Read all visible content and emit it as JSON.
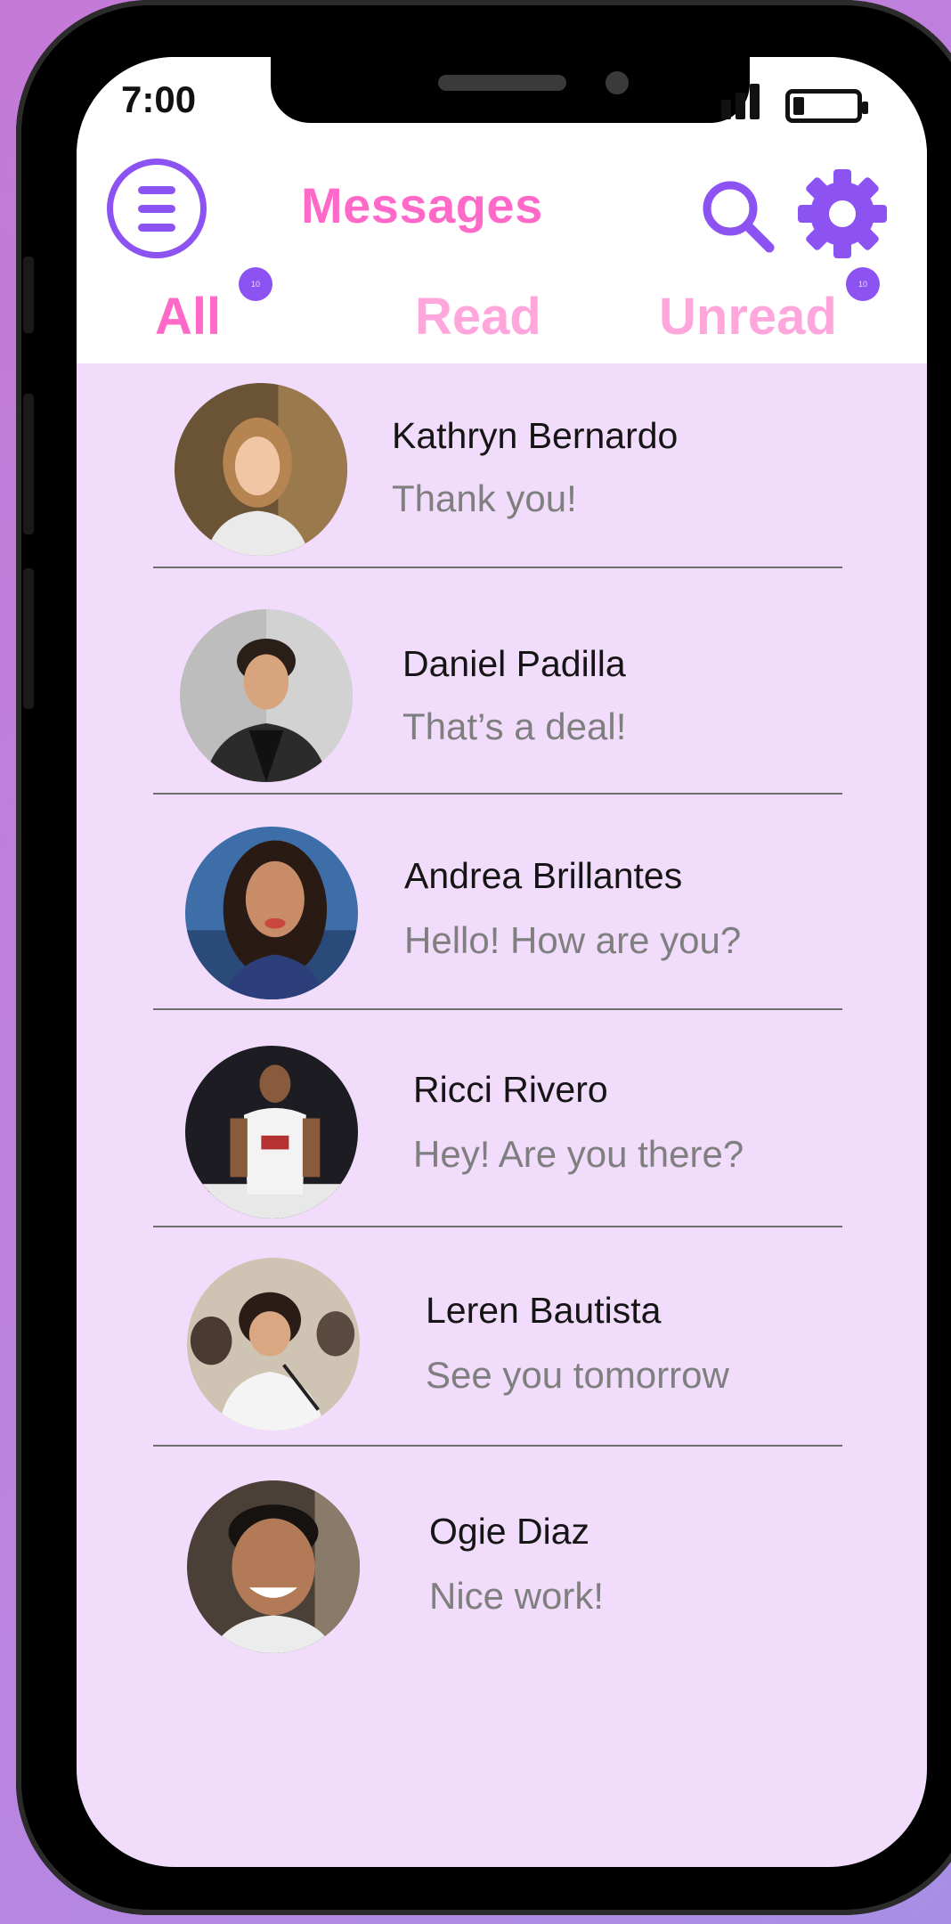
{
  "status_bar": {
    "time": "7:00"
  },
  "header": {
    "title": "Messages",
    "menu_icon": "hamburger-menu-icon",
    "search_icon": "search-icon",
    "settings_icon": "gear-icon"
  },
  "tabs": [
    {
      "label": "All",
      "badge": "10"
    },
    {
      "label": "Read"
    },
    {
      "label": "Unread",
      "badge": "10"
    }
  ],
  "conversations": [
    {
      "name": "Kathryn Bernardo",
      "preview": "Thank you!"
    },
    {
      "name": "Daniel Padilla",
      "preview": "That’s a deal!"
    },
    {
      "name": "Andrea Brillantes",
      "preview": "Hello! How are you?"
    },
    {
      "name": "Ricci Rivero",
      "preview": "Hey! Are you there?"
    },
    {
      "name": "Leren Bautista",
      "preview": "See you tomorrow"
    },
    {
      "name": "Ogie Diaz",
      "preview": "Nice work!"
    }
  ],
  "colors": {
    "accent_purple": "#8c52f2",
    "title_pink": "#ff69c8",
    "tab_inactive_pink": "#ffa6dc",
    "list_background": "#f2dcfb"
  }
}
